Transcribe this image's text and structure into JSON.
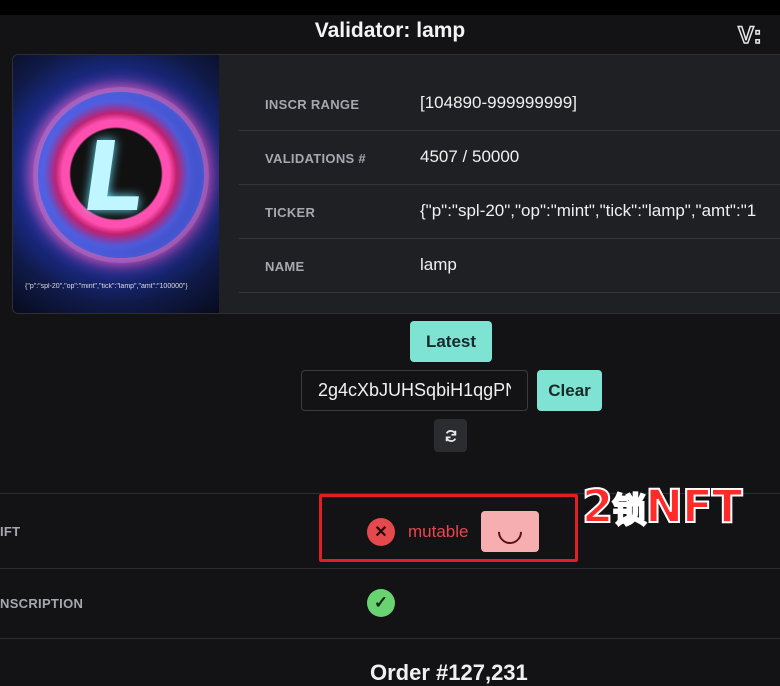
{
  "header": {
    "title": "Validator: lamp",
    "logo_text": "V:"
  },
  "token": {
    "image_caption": "{\"p\":\"spl-20\",\"op\":\"mint\",\"tick\":\"lamp\",\"amt\":\"100000\"}",
    "image_letter": "L",
    "rows": [
      {
        "label": "INSCR RANGE",
        "value": "[104890-999999999]"
      },
      {
        "label": "VALIDATIONS #",
        "value": "4507 / 50000"
      },
      {
        "label": "TICKER",
        "value": "{\"p\":\"spl-20\",\"op\":\"mint\",\"tick\":\"lamp\",\"amt\":\"1"
      },
      {
        "label": "NAME",
        "value": "lamp"
      }
    ]
  },
  "controls": {
    "latest_label": "Latest",
    "address_value": "2g4cXbJUHSqbiH1qgPN",
    "clear_label": "Clear",
    "refresh_icon": "refresh-icon"
  },
  "status_table": {
    "rows": [
      {
        "label": "IFT",
        "status": "mutable",
        "status_icon": "x-icon",
        "status_color": "#e5484d"
      },
      {
        "label": "NSCRIPTION",
        "status_icon": "check-icon",
        "status_color": "#69d372"
      }
    ]
  },
  "annotation": {
    "number": "2",
    "text_cn": "锁",
    "text_en": "NFT",
    "color": "#ff2b2b"
  },
  "footer": {
    "order_text": "Order #127,231"
  },
  "colors": {
    "accent": "#7ee3d3",
    "background": "#131316",
    "card": "#1f2024",
    "error": "#e5484d",
    "success": "#69d372"
  }
}
